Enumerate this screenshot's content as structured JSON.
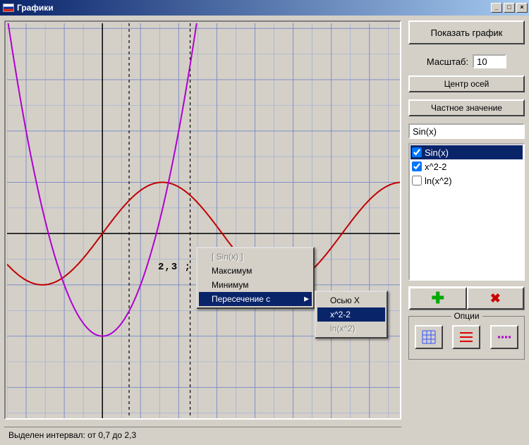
{
  "window": {
    "title": "Графики"
  },
  "side": {
    "show_button": "Показать график",
    "scale_label": "Масштаб:",
    "scale_value": "10",
    "center_button": "Центр осей",
    "value_button": "Частное значение",
    "formula_value": "Sin(x)",
    "list": [
      {
        "label": "Sin(x)",
        "checked": true,
        "selected": true
      },
      {
        "label": "x^2-2",
        "checked": true,
        "selected": false
      },
      {
        "label": "ln(x^2)",
        "checked": false,
        "selected": false
      }
    ],
    "options_label": "Опции"
  },
  "status": "Выделен интервал: от 0,7 до 2,3",
  "coord_label": "2,3 ;",
  "context_menu": {
    "items": [
      {
        "label": "[ Sin(x) ]",
        "disabled": true
      },
      {
        "label": "Максимум",
        "disabled": false
      },
      {
        "label": "Минимум",
        "disabled": false
      },
      {
        "label": "Пересечение с",
        "disabled": false,
        "hover": true,
        "submenu": true
      }
    ]
  },
  "submenu": {
    "items": [
      {
        "label": "Осью  X",
        "disabled": false
      },
      {
        "label": "x^2-2",
        "disabled": false,
        "hover": true
      },
      {
        "label": "ln(x^2)",
        "disabled": true
      }
    ]
  },
  "chart_data": {
    "type": "line",
    "xlim": [
      -2.5,
      7.8
    ],
    "ylim": [
      -3.6,
      4.1
    ],
    "grid": true,
    "axes_origin": [
      0,
      0
    ],
    "selection_interval": [
      0.7,
      2.3
    ],
    "series": [
      {
        "name": "Sin(x)",
        "color": "#c00000",
        "formula": "sin(x)"
      },
      {
        "name": "x^2-2",
        "color": "#b000d0",
        "formula": "x*x-2",
        "visible_x_range": [
          -2.5,
          2.5
        ]
      }
    ]
  }
}
